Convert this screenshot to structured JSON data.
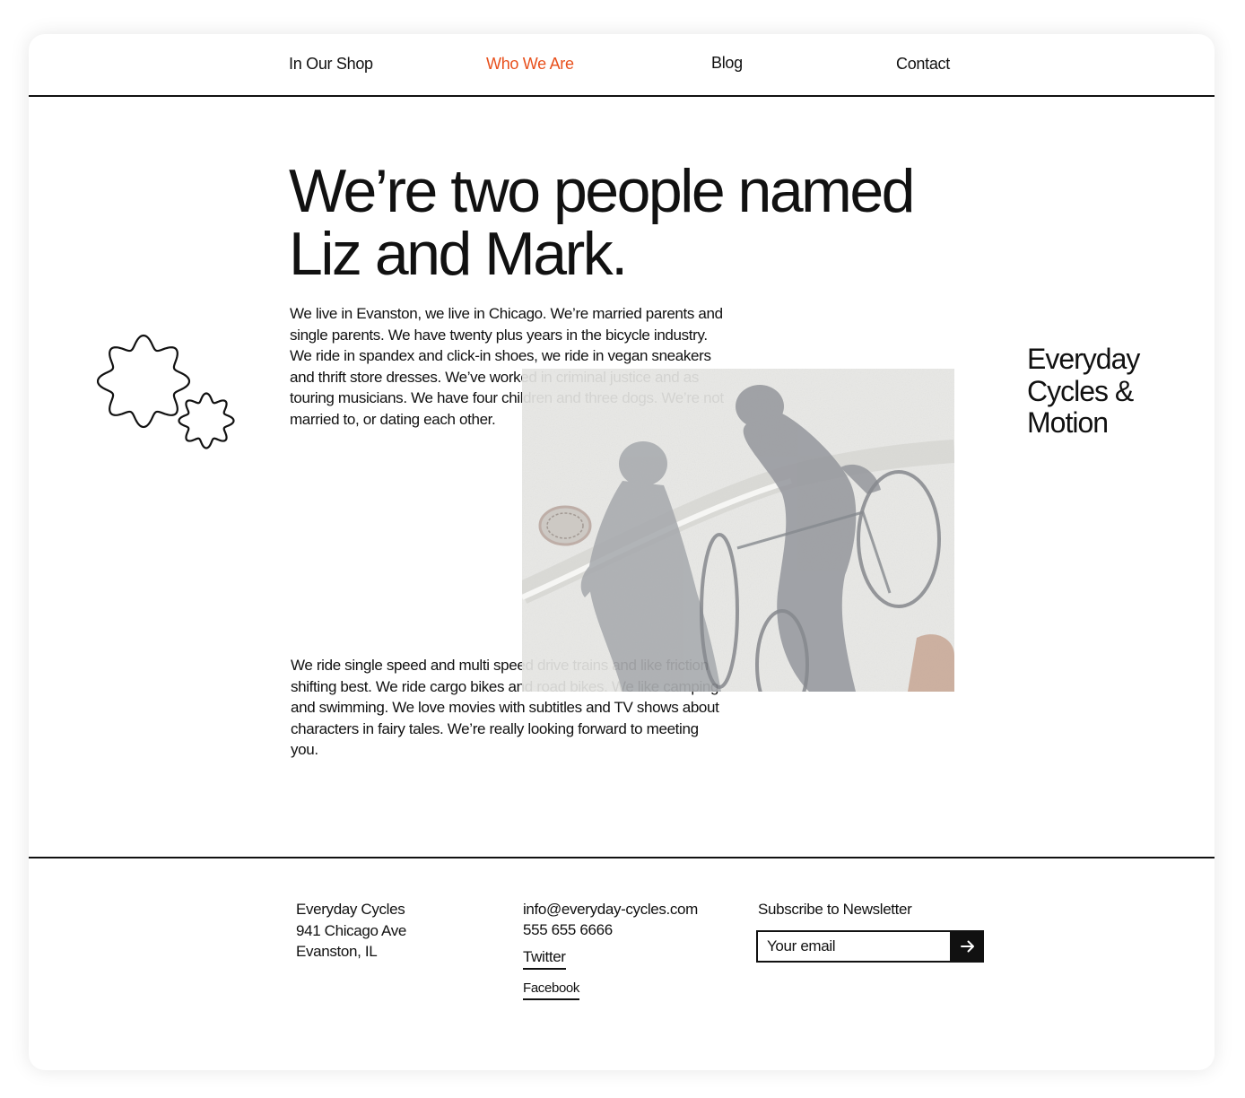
{
  "nav": {
    "items": [
      {
        "label": "In Our Shop",
        "active": false
      },
      {
        "label": "Who We Are",
        "active": true
      },
      {
        "label": "Blog",
        "active": false
      },
      {
        "label": "Contact",
        "active": false
      }
    ],
    "active_color": "#e8501c"
  },
  "hero": {
    "headline": "We’re two people named Liz and Mark.",
    "paragraph_1": "We live in Evanston, we live in Chicago. We’re married parents and single parents. We have twenty plus years in the bicycle industry. We ride in spandex and click-in shoes, we ride in vegan sneakers and thrift store dresses. We’ve worked in criminal justice and as touring musicians. We have four children and three dogs. We’re not married to, or dating each other.",
    "paragraph_2": "We ride single speed and multi speed drive trains and like friction shifting best. We ride cargo bikes and road bikes. We like camping and swimming. We love movies with subtitles and TV shows about characters in fairy tales. We’re really looking forward to meeting you.",
    "gears_icon": "gears-icon",
    "photo": "shadows-of-two-cyclists-photo"
  },
  "brand": {
    "lines": [
      "Everyday",
      "Cycles &",
      "Motion"
    ]
  },
  "footer": {
    "address": [
      "Everyday Cycles",
      "941 Chicago Ave",
      "Evanston, IL"
    ],
    "email": "info@everyday-cycles.com",
    "phone": "555 655 6666",
    "twitter_label": "Twitter",
    "facebook_label": "Facebook",
    "newsletter": {
      "label": "Subscribe to Newsletter",
      "placeholder": "Your email",
      "submit_icon": "arrow-right-icon"
    }
  }
}
